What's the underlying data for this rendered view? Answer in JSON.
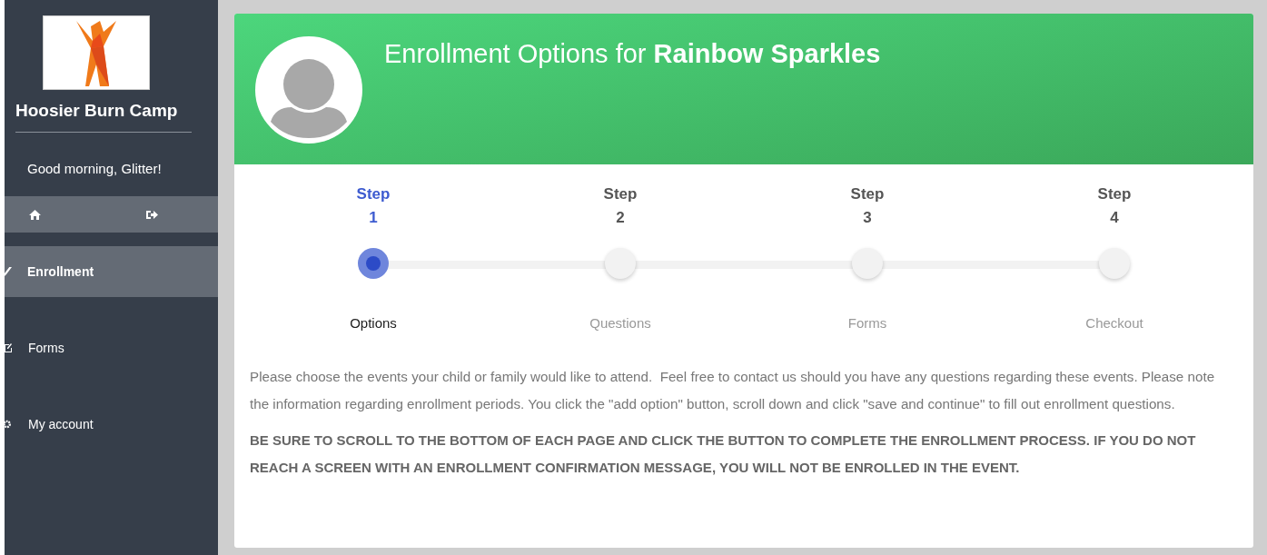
{
  "sidebar": {
    "brand": "Hoosier Burn Camp",
    "greeting": "Good morning, Glitter!",
    "items": [
      {
        "label": "Enrollment",
        "selected": true
      },
      {
        "label": "Forms",
        "selected": false
      },
      {
        "label": "My account",
        "selected": false
      }
    ]
  },
  "header": {
    "title": "Enrollment Options for **Rainbow Sparkles**"
  },
  "steps": [
    {
      "label": "Step",
      "number": "1",
      "name": "Options",
      "selected": true
    },
    {
      "label": "Step",
      "number": "2",
      "name": "Questions",
      "selected": false
    },
    {
      "label": "Step",
      "number": "3",
      "name": "Forms",
      "selected": false
    },
    {
      "label": "Step",
      "number": "4",
      "name": "Checkout",
      "selected": false
    }
  ],
  "intro": "Please choose the events your child or family would like to attend.  Feel free to contact us should you have any questions regarding these events. Please note the information regarding enrollment periods. You click the \"add option\" button, scroll down and click \"save and continue\" to fill out enrollment questions.",
  "warning": "BE SURE TO SCROLL TO THE BOTTOM OF EACH PAGE AND CLICK THE BUTTON TO COMPLETE THE ENROLLMENT PROCESS. IF YOU DO NOT REACH A SCREEN WITH AN ENROLLMENT CONFIRMATION MESSAGE, YOU WILL NOT BE ENROLLED IN THE EVENT."
}
